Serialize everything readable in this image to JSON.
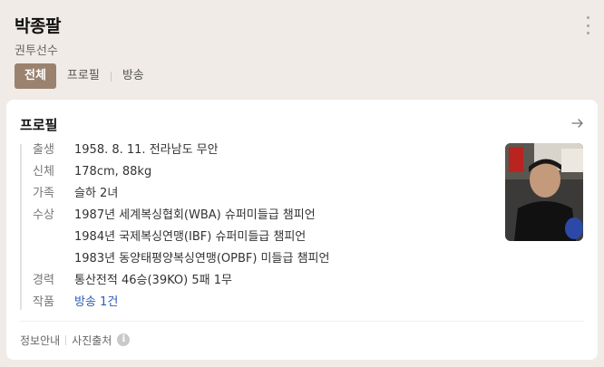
{
  "header": {
    "name": "박종팔",
    "subtitle": "권투선수",
    "more_icon": "more-vertical-icon",
    "tabs": [
      {
        "label": "전체",
        "active": true
      },
      {
        "label": "프로필",
        "active": false
      },
      {
        "label": "방송",
        "active": false
      }
    ]
  },
  "profile": {
    "title": "프로필",
    "arrow_icon": "arrow-right-icon",
    "rows": [
      {
        "label": "출생",
        "values": [
          "1958. 8. 11. 전라남도 무안"
        ]
      },
      {
        "label": "신체",
        "values": [
          "178cm, 88kg"
        ]
      },
      {
        "label": "가족",
        "values": [
          "슬하 2녀"
        ]
      },
      {
        "label": "수상",
        "values": [
          "1987년 세계복싱협회(WBA) 슈퍼미들급 챔피언",
          "1984년 국제복싱연맹(IBF) 슈퍼미들급 챔피언",
          "1983년 동양태평양복싱연맹(OPBF) 미들급 챔피언"
        ]
      },
      {
        "label": "경력",
        "values": [
          "통산전적 46승(39KO) 5패 1무"
        ]
      },
      {
        "label": "작품",
        "values": [
          "방송 1건"
        ],
        "link": true
      }
    ],
    "photo_alt": "profile-photo",
    "footer": {
      "info_label": "정보안내",
      "photo_source": "사진출처",
      "info_icon": "info-icon"
    }
  },
  "colors": {
    "background": "#f0ebe6",
    "active_tab": "#9a826f",
    "link": "#2f5bb7"
  }
}
